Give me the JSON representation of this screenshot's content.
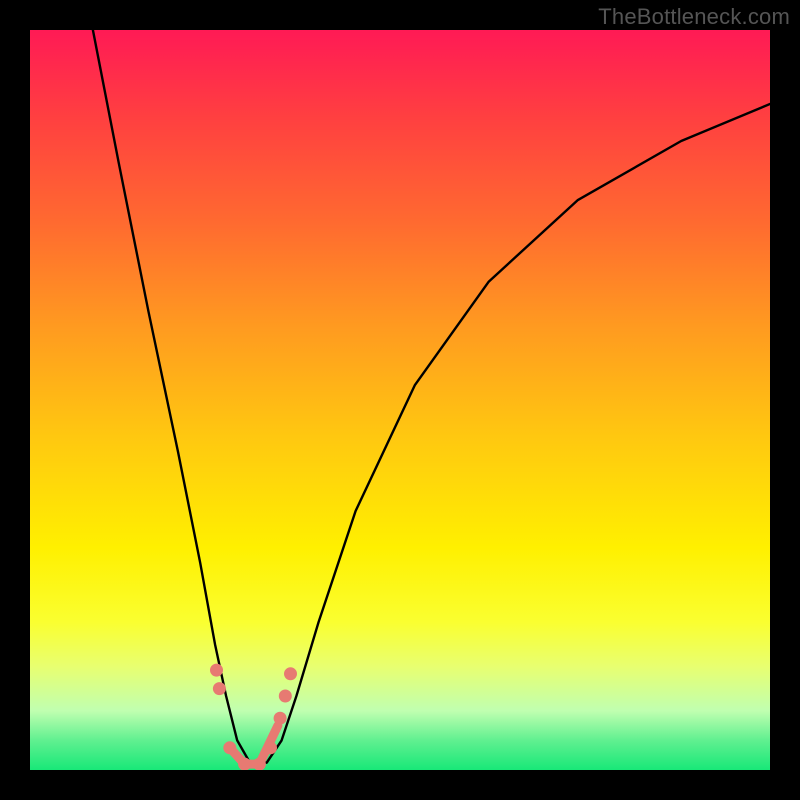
{
  "watermark": "TheBottleneck.com",
  "chart_data": {
    "type": "line",
    "title": "",
    "xlabel": "",
    "ylabel": "",
    "xlim": [
      0,
      100
    ],
    "ylim": [
      0,
      100
    ],
    "note": "x and y are in percent of plot area (0 = left/bottom, 100 = right/top). Single V-shaped curve with minimum near x ≈ 30.",
    "series": [
      {
        "name": "curve",
        "x": [
          8.5,
          12,
          16,
          20,
          23,
          25,
          26.5,
          28,
          30,
          32,
          34,
          36,
          39,
          44,
          52,
          62,
          74,
          88,
          100
        ],
        "y": [
          100,
          82,
          62,
          43,
          28,
          17,
          10,
          4,
          0.5,
          1,
          4,
          10,
          20,
          35,
          52,
          66,
          77,
          85,
          90
        ]
      }
    ],
    "markers": {
      "name": "highlight-points",
      "comment": "salmon dots clustered near the curve minimum",
      "x": [
        25.2,
        25.6,
        27,
        29,
        31,
        32.5,
        33.8,
        34.5,
        35.2
      ],
      "y": [
        13.5,
        11,
        3,
        0.8,
        0.8,
        3,
        7,
        10,
        13
      ]
    }
  }
}
